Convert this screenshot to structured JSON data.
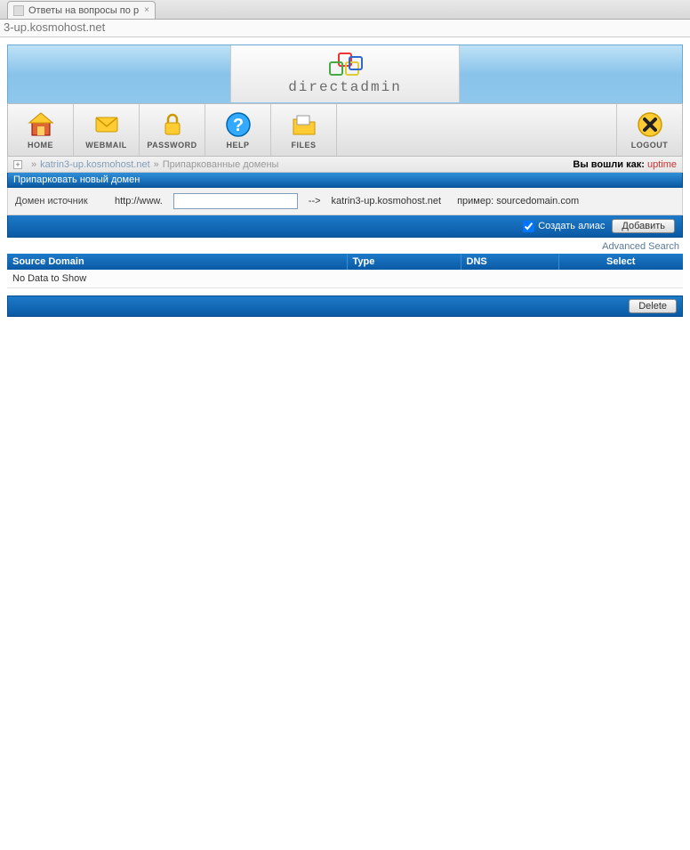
{
  "browser": {
    "tab_title": "Ответы на вопросы по р",
    "url": "3-up.kosmohost.net"
  },
  "logo": {
    "text": "directadmin"
  },
  "toolbar": {
    "home": "HOME",
    "webmail": "WEBMAIL",
    "password": "PASSWORD",
    "help": "HELP",
    "files": "FILES",
    "logout": "LOGOUT"
  },
  "breadcrumb": {
    "sep": "»",
    "link": "katrin3-up.kosmohost.net",
    "current": "Припаркованные домены",
    "logged_as_label": "Вы вошли как:",
    "user": "uptime"
  },
  "park": {
    "header": "Припарковать новый домен",
    "source_label": "Домен источник",
    "prefix": "http://www.",
    "input_value": "",
    "suffix_arrow": "-->",
    "suffix_domain": "katrin3-up.kosmohost.net",
    "example": "пример: sourcedomain.com",
    "alias_label": "Создать алиас",
    "alias_checked": true,
    "add_btn": "Добавить"
  },
  "advanced_search": "Advanced Search",
  "table": {
    "col_source": "Source Domain",
    "col_type": "Type",
    "col_dns": "DNS",
    "col_select": "Select",
    "empty": "No Data to Show"
  },
  "delete_btn": "Delete"
}
